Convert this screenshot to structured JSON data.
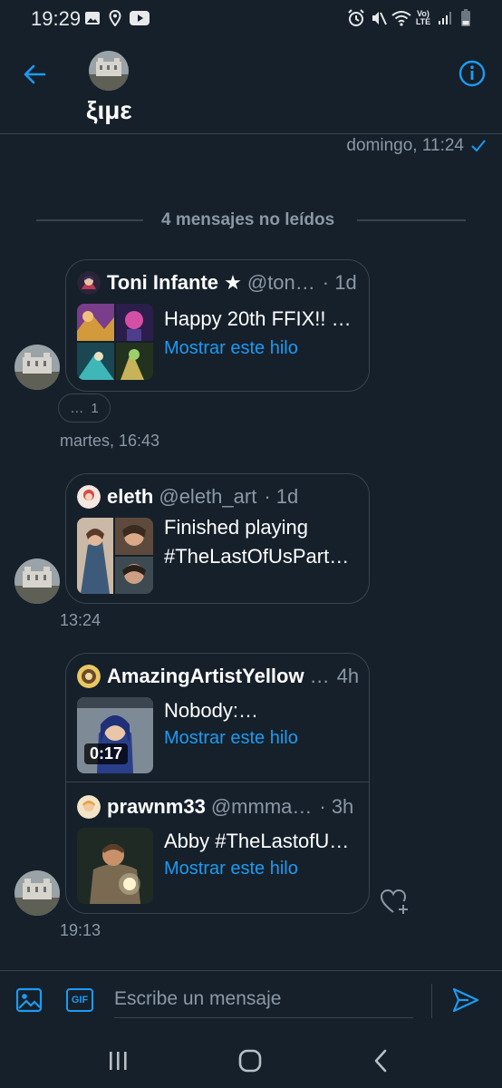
{
  "status_bar": {
    "time": "19:29",
    "icons": [
      "gallery-icon",
      "location-pin-icon",
      "youtube-icon",
      "alarm-icon",
      "mute-icon",
      "wifi-icon",
      "volte-icon",
      "signal-icon",
      "battery-icon"
    ],
    "volte_top": "Vo)",
    "volte_bottom": "LTE"
  },
  "header": {
    "name": "ξιμε",
    "back_icon": "arrow-left-icon",
    "info_icon": "info-icon"
  },
  "sent_status": {
    "time": "domingo, 11:24",
    "icon": "checkmark-icon"
  },
  "unread_divider": "4 mensajes no leídos",
  "messages": [
    {
      "tweet": {
        "name": "Toni Infante ★",
        "handle": "@ton…",
        "age": "· 1d",
        "text": "Happy 20th FFIX!! …",
        "link": "Mostrar este hilo"
      },
      "reaction": {
        "glyph": "…",
        "count": "1"
      },
      "timestamp": "martes, 16:43"
    },
    {
      "tweet": {
        "name": "eleth",
        "handle": "@eleth_art",
        "age": "· 1d",
        "text_line1": "Finished playing",
        "text_line2": "#TheLastOfUsPart…"
      },
      "timestamp": "13:24"
    },
    {
      "tweets": [
        {
          "name": "AmazingArtistYellow",
          "handle": "…",
          "age": "4h",
          "text": "Nobody:…",
          "link": "Mostrar este hilo",
          "video_duration": "0:17"
        },
        {
          "name": "prawnm33",
          "handle": "@mmma…",
          "age": "· 3h",
          "text": "Abby #TheLastofU…",
          "link": "Mostrar este hilo"
        }
      ],
      "timestamp": "19:13",
      "like_icon": "heart-plus-icon"
    }
  ],
  "composer": {
    "placeholder": "Escribe un mensaje",
    "image_icon": "image-icon",
    "gif_label": "GIF",
    "send_icon": "send-icon"
  },
  "nav_bar": {
    "icons": [
      "recent-apps-icon",
      "home-icon",
      "back-icon"
    ]
  },
  "colors": {
    "background": "#15202b",
    "accent": "#1d9bf0",
    "secondary_text": "#8b98a5",
    "border": "#38444d"
  }
}
